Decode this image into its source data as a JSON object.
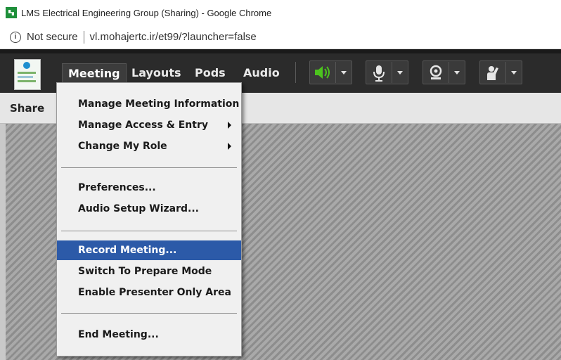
{
  "window": {
    "title": "LMS Electrical Engineering Group (Sharing) - Google Chrome"
  },
  "address_bar": {
    "security_label": "Not secure",
    "url": "vl.mohajertc.ir/et99/?launcher=false"
  },
  "menubar": {
    "items": [
      "Meeting",
      "Layouts",
      "Pods",
      "Audio"
    ],
    "active": "Meeting"
  },
  "toolbar": {
    "controls": [
      "speaker-icon",
      "microphone-icon",
      "webcam-icon",
      "raise-hand-icon"
    ],
    "speaker_accent": "#4cc31e"
  },
  "pod": {
    "title": "Share"
  },
  "meeting_menu": {
    "group1": [
      {
        "label": "Manage Meeting Information",
        "submenu": false
      },
      {
        "label": "Manage Access & Entry",
        "submenu": true
      },
      {
        "label": "Change My Role",
        "submenu": true
      }
    ],
    "group2": [
      {
        "label": "Preferences..."
      },
      {
        "label": "Audio Setup Wizard..."
      }
    ],
    "group3": [
      {
        "label": "Record Meeting...",
        "highlighted": true
      },
      {
        "label": "Switch To Prepare Mode"
      },
      {
        "label": "Enable Presenter Only Area"
      }
    ],
    "group4": [
      {
        "label": "End Meeting..."
      }
    ]
  }
}
